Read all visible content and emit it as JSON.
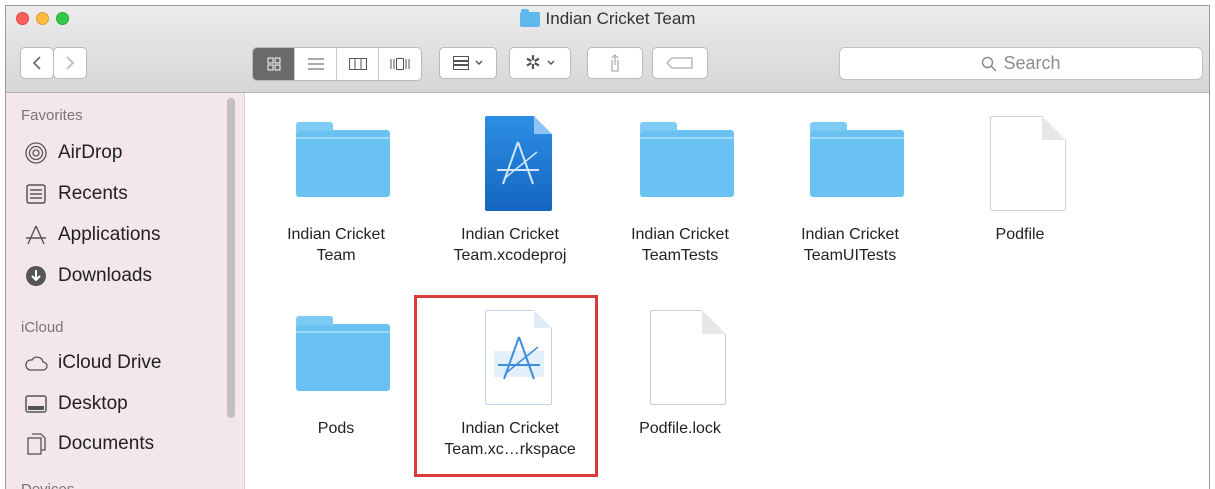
{
  "window": {
    "title": "Indian Cricket Team"
  },
  "toolbar": {
    "back_icon": "chevron-left-icon",
    "forward_icon": "chevron-right-icon",
    "views": [
      "icon-view-icon",
      "list-view-icon",
      "column-view-icon",
      "coverflow-view-icon"
    ],
    "arrange_icon": "arrange-grid-icon",
    "action_icon": "gear-icon",
    "share_icon": "share-icon",
    "tags_icon": "tag-icon",
    "search_placeholder": "Search"
  },
  "sidebar": {
    "sections": [
      {
        "header": "Favorites",
        "items": [
          {
            "label": "AirDrop",
            "icon": "airdrop-icon"
          },
          {
            "label": "Recents",
            "icon": "recents-icon"
          },
          {
            "label": "Applications",
            "icon": "applications-icon"
          },
          {
            "label": "Downloads",
            "icon": "downloads-icon"
          }
        ]
      },
      {
        "header": "iCloud",
        "items": [
          {
            "label": "iCloud Drive",
            "icon": "cloud-icon"
          },
          {
            "label": "Desktop",
            "icon": "desktop-icon"
          },
          {
            "label": "Documents",
            "icon": "documents-icon"
          }
        ]
      },
      {
        "header": "Devices",
        "items": []
      }
    ]
  },
  "files": [
    {
      "label": "Indian Cricket\nTeam",
      "kind": "folder"
    },
    {
      "label": "Indian Cricket\nTeam.xcodeproj",
      "kind": "xcodeproj"
    },
    {
      "label": "Indian Cricket\nTeamTests",
      "kind": "folder"
    },
    {
      "label": "Indian Cricket\nTeamUITests",
      "kind": "folder"
    },
    {
      "label": "Podfile",
      "kind": "document"
    },
    {
      "label": "Pods",
      "kind": "folder"
    },
    {
      "label": "Indian Cricket\nTeam.xc…rkspace",
      "kind": "xcworkspace",
      "highlighted": true
    },
    {
      "label": "Podfile.lock",
      "kind": "document"
    }
  ],
  "colors": {
    "highlight_border": "#d93a3a",
    "folder": "#6ac2f2",
    "sidebar_bg": "#f3e7ea"
  }
}
